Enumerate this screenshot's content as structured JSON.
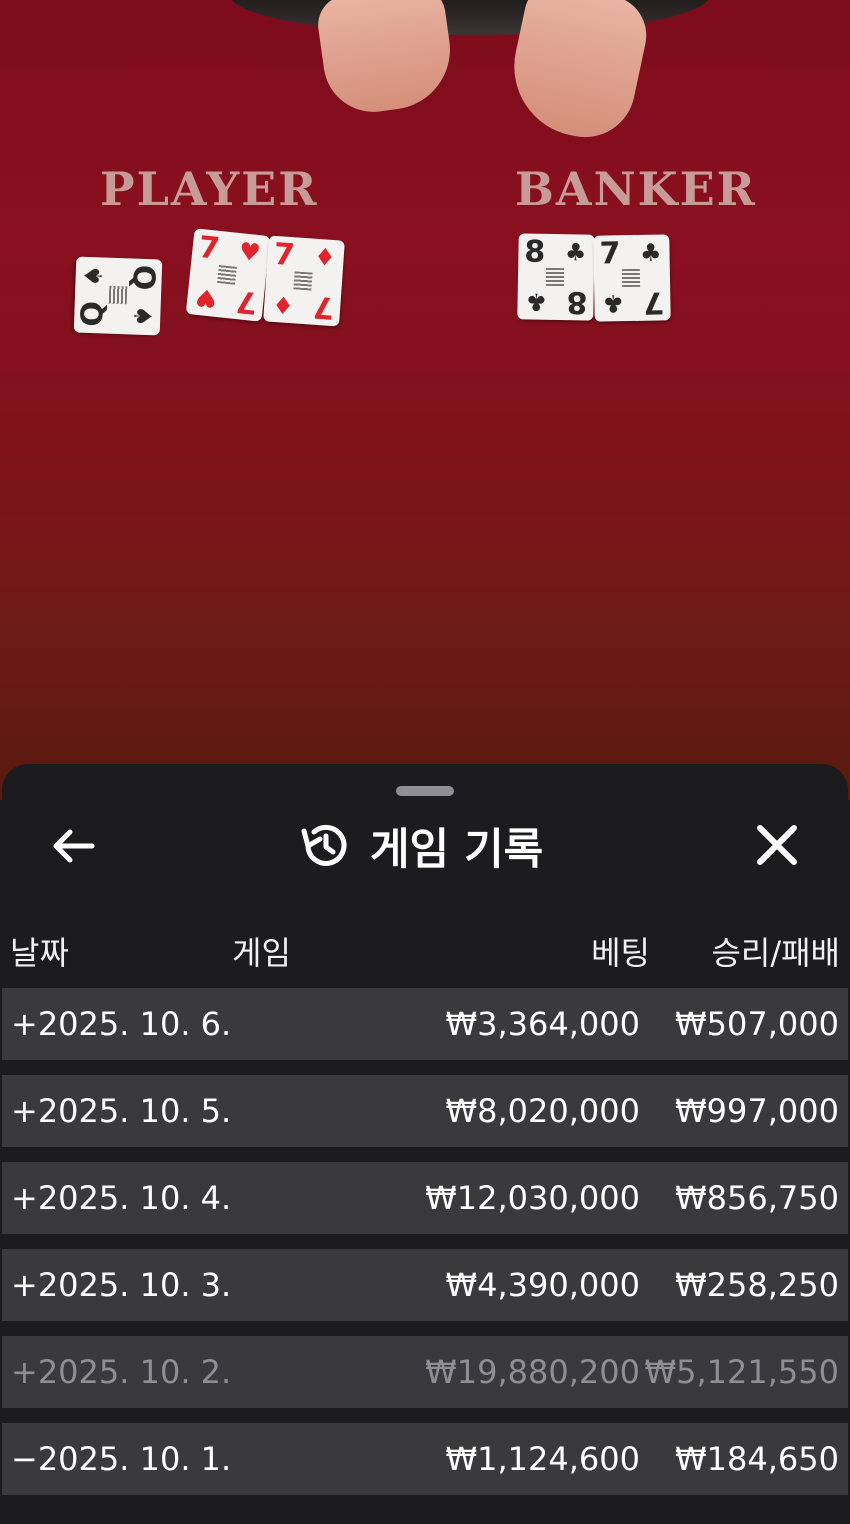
{
  "table": {
    "player_label": "PLAYER",
    "banker_label": "BANKER",
    "player_cards": [
      {
        "rank": "Q",
        "suit": "♠",
        "color": "black"
      },
      {
        "rank": "7",
        "suit": "♥",
        "color": "red"
      },
      {
        "rank": "7",
        "suit": "♦",
        "color": "red"
      }
    ],
    "banker_cards": [
      {
        "rank": "8",
        "suit": "♣",
        "color": "black"
      },
      {
        "rank": "7",
        "suit": "♣",
        "color": "black"
      }
    ]
  },
  "sheet": {
    "title": "게임 기록",
    "icons": {
      "back": "arrow-left-icon",
      "history": "history-icon",
      "close": "close-icon"
    },
    "columns": {
      "date": "날짜",
      "game": "게임",
      "bet": "베팅",
      "result": "승리/패배"
    },
    "rows": [
      {
        "date": "+2025. 10. 6.",
        "bet": "₩3,364,000",
        "result": "₩507,000",
        "dimmed": false
      },
      {
        "date": "+2025. 10. 5.",
        "bet": "₩8,020,000",
        "result": "₩997,000",
        "dimmed": false
      },
      {
        "date": "+2025. 10. 4.",
        "bet": "₩12,030,000",
        "result": "₩856,750",
        "dimmed": false
      },
      {
        "date": "+2025. 10. 3.",
        "bet": "₩4,390,000",
        "result": "₩258,250",
        "dimmed": false
      },
      {
        "date": "+2025. 10. 2.",
        "bet": "₩19,880,200",
        "result": "₩5,121,550",
        "dimmed": true
      },
      {
        "date": "−2025. 10. 1.",
        "bet": "₩1,124,600",
        "result": "₩184,650",
        "dimmed": false
      }
    ]
  },
  "colors": {
    "felt": "#8a101f",
    "sheet_bg": "#1c1c1e",
    "row_bg": "#3a3a3c",
    "dim_text": "#8e8e93",
    "card_red": "#e0242e"
  }
}
